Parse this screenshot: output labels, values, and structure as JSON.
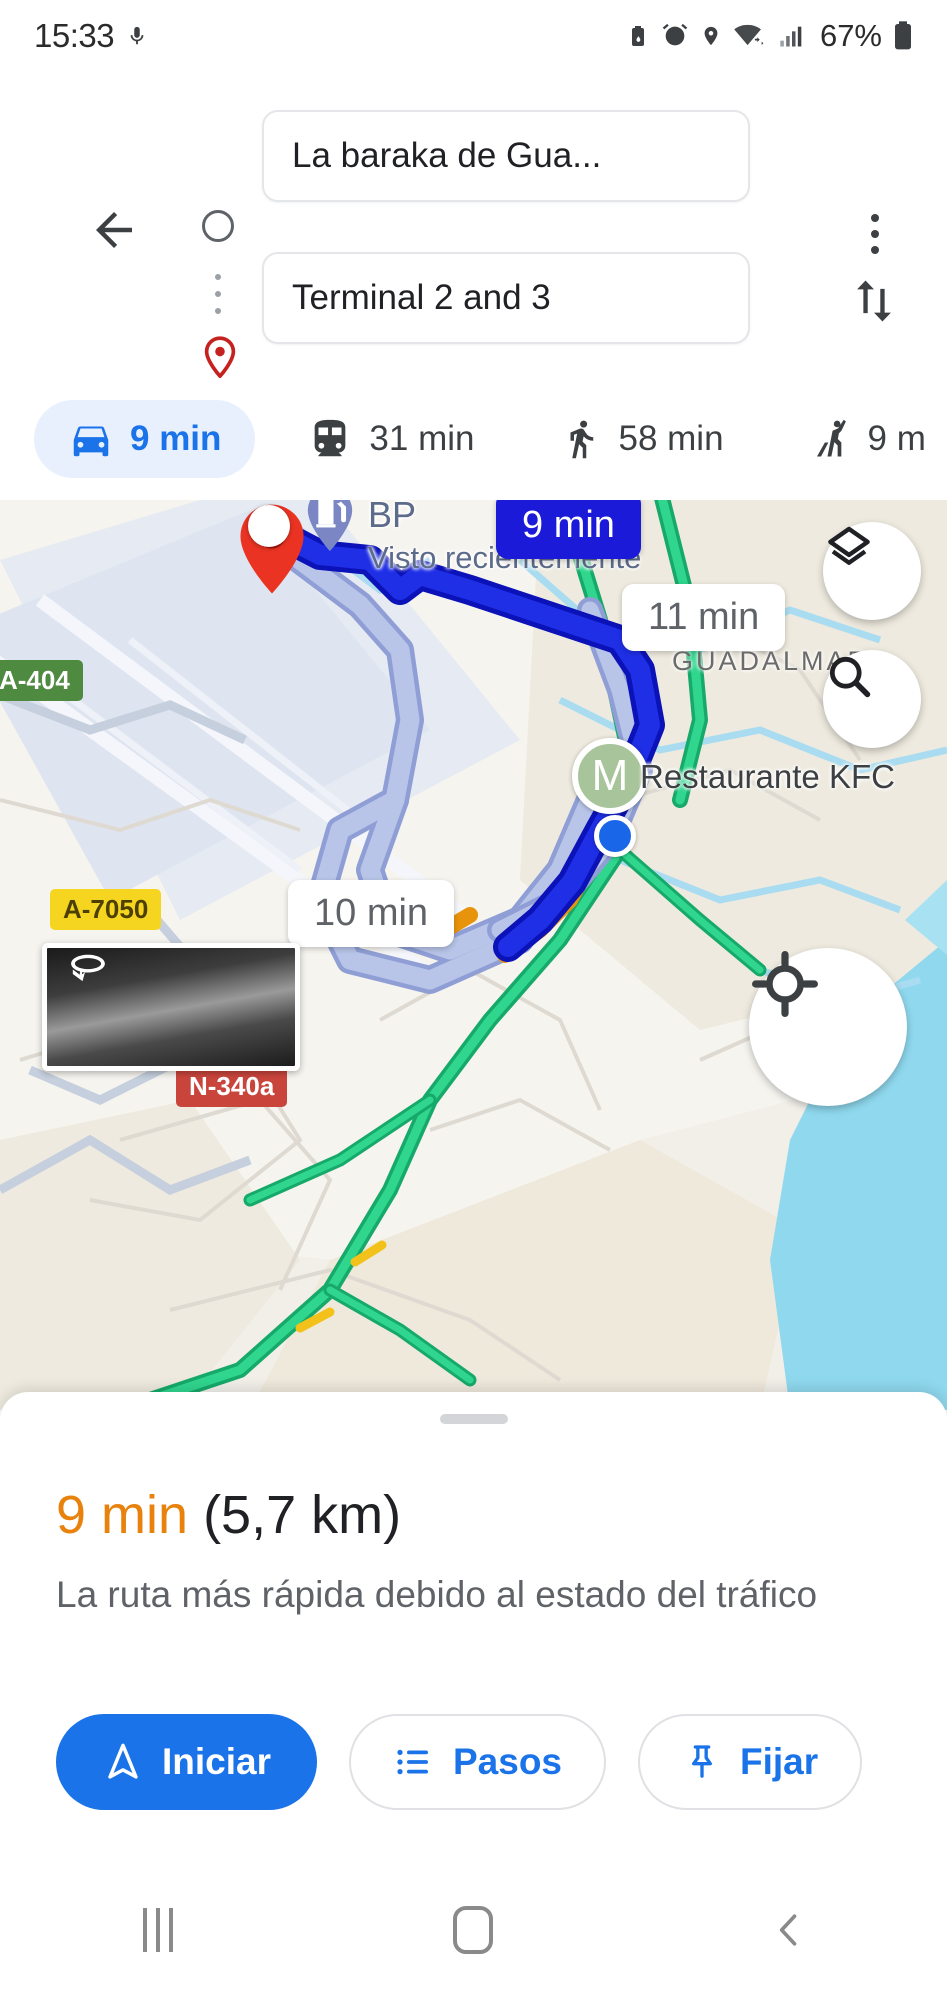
{
  "status_bar": {
    "time": "15:33",
    "battery_percent": "67%",
    "icons": [
      "mic-icon",
      "battery-saver-icon",
      "alarm-icon",
      "location-icon",
      "wifi-icon",
      "signal-icon",
      "battery-icon"
    ]
  },
  "header": {
    "origin_value": "La baraka de Gua...",
    "destination_value": "Terminal 2 and 3",
    "back_icon": "back-arrow-icon",
    "overflow_icon": "more-vert-icon",
    "swap_icon": "swap-vert-icon",
    "origin_node_icon": "origin-circle-icon",
    "destination_node_icon": "destination-pin-icon"
  },
  "modes": [
    {
      "id": "driving",
      "icon": "car-icon",
      "label": "9 min",
      "selected": true
    },
    {
      "id": "transit",
      "icon": "train-icon",
      "label": "31 min",
      "selected": false
    },
    {
      "id": "walking",
      "icon": "walk-icon",
      "label": "58 min",
      "selected": false
    },
    {
      "id": "rideshare",
      "icon": "taxi-hail-icon",
      "label": "9 m",
      "selected": false
    }
  ],
  "map": {
    "poi_name": "BP",
    "poi_subtitle": "Visto recientemente",
    "neighborhood": "GUADALMAR",
    "place_kfc": "Restaurante KFC",
    "route_label_main": "9 min",
    "route_label_alt1": "11 min",
    "route_label_alt2": "10 min",
    "shields": [
      {
        "id": "a404",
        "label": "A-404",
        "color": "#4e8a3f"
      },
      {
        "id": "a7050",
        "label": "A-7050",
        "color": "#f5d520"
      },
      {
        "id": "n340a",
        "label": "N-340a",
        "color": "#c9453c"
      }
    ],
    "marker_transit_label": "M",
    "controls": {
      "layers_icon": "layers-icon",
      "search_icon": "search-icon",
      "locate_icon": "my-location-icon",
      "streetview_icon": "streetview-rotate-icon"
    },
    "colors": {
      "route_selected": "#1a1ad8",
      "route_alternate": "#a3b4e8",
      "traffic_green": "#1ec275",
      "traffic_orange": "#e8930c",
      "water": "#8fd8ee",
      "land": "#f2efe9"
    }
  },
  "sheet": {
    "duration": "9 min",
    "distance": "(5,7 km)",
    "description": "La ruta más rápida debido al estado del tráfico",
    "buttons": [
      {
        "id": "start",
        "label": "Iniciar",
        "icon": "navigation-arrow-icon"
      },
      {
        "id": "steps",
        "label": "Pasos",
        "icon": "list-icon"
      },
      {
        "id": "pin",
        "label": "Fijar",
        "icon": "pin-icon"
      }
    ]
  },
  "navbar": {
    "recents_icon": "recents-icon",
    "home_icon": "home-icon",
    "back_icon": "back-chevron-icon"
  }
}
